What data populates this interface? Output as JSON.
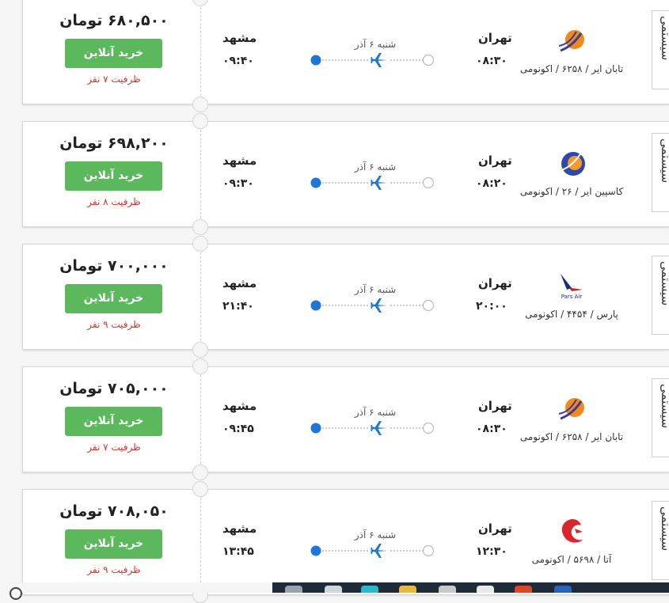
{
  "currency": "تومان",
  "buy_label": "خرید آنلاین",
  "system_label": "سیستمی",
  "colors": {
    "buy": "#5cb85c",
    "capacity": "#d9302c",
    "route_dot": "#1e77d6",
    "plane": "#1e77d6"
  },
  "flights": [
    {
      "price": "۶۸۰,۵۰۰ تومان",
      "capacity": "ظرفیت ۷ نفر",
      "origin": "تهران",
      "depart": "۰۸:۳۰",
      "destination": "مشهد",
      "arrive": "۰۹:۴۰",
      "date": "شنبه ۶ آذر",
      "airline_info": "تابان ایر / ۶۲۵۸ / اکونومی",
      "logo": "taban-logo-icon"
    },
    {
      "price": "۶۹۸,۲۰۰ تومان",
      "capacity": "ظرفیت ۸ نفر",
      "origin": "تهران",
      "depart": "۰۸:۲۰",
      "destination": "مشهد",
      "arrive": "۰۹:۳۰",
      "date": "شنبه ۶ آذر",
      "airline_info": "کاسپین ایر / ۲۶ / اکونومی",
      "logo": "caspian-logo-icon"
    },
    {
      "price": "۷۰۰,۰۰۰ تومان",
      "capacity": "ظرفیت ۹ نفر",
      "origin": "تهران",
      "depart": "۲۰:۰۰",
      "destination": "مشهد",
      "arrive": "۲۱:۴۰",
      "date": "شنبه ۶ آذر",
      "airline_info": "پارس / ۴۴۵۴ / اکونومی",
      "logo": "pars-air-logo-icon",
      "logo_text": "Pars Air"
    },
    {
      "price": "۷۰۵,۰۰۰ تومان",
      "capacity": "ظرفیت ۷ نفر",
      "origin": "تهران",
      "depart": "۰۸:۳۰",
      "destination": "مشهد",
      "arrive": "۰۹:۴۵",
      "date": "شنبه ۶ آذر",
      "airline_info": "تابان ایر / ۶۲۵۸ / اکونومی",
      "logo": "taban-logo-icon"
    },
    {
      "price": "۷۰۸,۰۵۰ تومان",
      "capacity": "ظرفیت ۹ نفر",
      "origin": "تهران",
      "depart": "۱۲:۳۰",
      "destination": "مشهد",
      "arrive": "۱۳:۴۵",
      "date": "شنبه ۶ آذر",
      "airline_info": "آتا / ۵۶۹۸ / اکونومی",
      "logo": "ata-logo-icon"
    }
  ]
}
